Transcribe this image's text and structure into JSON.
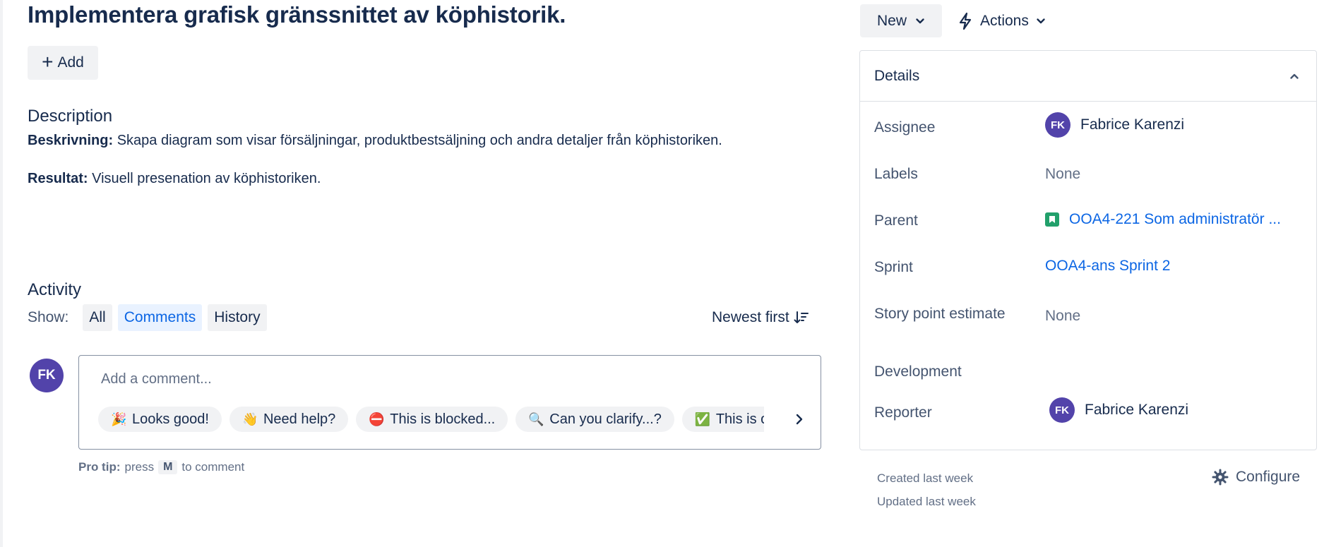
{
  "issue": {
    "title": "Implementera grafisk gränssnittet av köphistorik.",
    "add_label": "Add"
  },
  "description": {
    "heading": "Description",
    "lines": [
      {
        "label": "Beskrivning:",
        "text": " Skapa diagram som visar försäljningar, produktbestsäljning och andra detaljer från köphistoriken."
      },
      {
        "label": "Resultat:",
        "text": " Visuell presenation av köphistoriken."
      }
    ]
  },
  "activity": {
    "heading": "Activity",
    "show_label": "Show:",
    "filters": [
      {
        "label": "All",
        "active": false
      },
      {
        "label": "Comments",
        "active": true
      },
      {
        "label": "History",
        "active": false
      }
    ],
    "sort_label": "Newest first",
    "comment": {
      "avatar_initials": "FK",
      "placeholder": "Add a comment...",
      "quick_replies": [
        {
          "emoji": "🎉",
          "label": "Looks good!"
        },
        {
          "emoji": "👋",
          "label": "Need help?"
        },
        {
          "emoji": "⛔",
          "label": "This is blocked..."
        },
        {
          "emoji": "🔍",
          "label": "Can you clarify...?"
        },
        {
          "emoji": "✅",
          "label": "This is on track"
        }
      ]
    },
    "pro_tip": {
      "label": "Pro tip:",
      "before": "press",
      "key": "M",
      "after": "to comment"
    }
  },
  "toolbar": {
    "status_label": "New",
    "actions_label": "Actions"
  },
  "details": {
    "heading": "Details",
    "fields": {
      "assignee": {
        "label": "Assignee",
        "initials": "FK",
        "value": "Fabrice Karenzi"
      },
      "labels": {
        "label": "Labels",
        "value": "None"
      },
      "parent": {
        "label": "Parent",
        "value": "OOA4-221 Som administratör ..."
      },
      "sprint": {
        "label": "Sprint",
        "value": "OOA4-ans Sprint 2"
      },
      "story_points": {
        "label": "Story point estimate",
        "value": "None"
      },
      "development": {
        "label": "Development"
      },
      "reporter": {
        "label": "Reporter",
        "initials": "FK",
        "value": "Fabrice Karenzi"
      }
    }
  },
  "meta": {
    "created": "Created last week",
    "updated": "Updated last week",
    "configure_label": "Configure"
  },
  "colors": {
    "avatar": "#5243aa",
    "link": "#0c66e4",
    "story_icon": "#22a06b"
  }
}
